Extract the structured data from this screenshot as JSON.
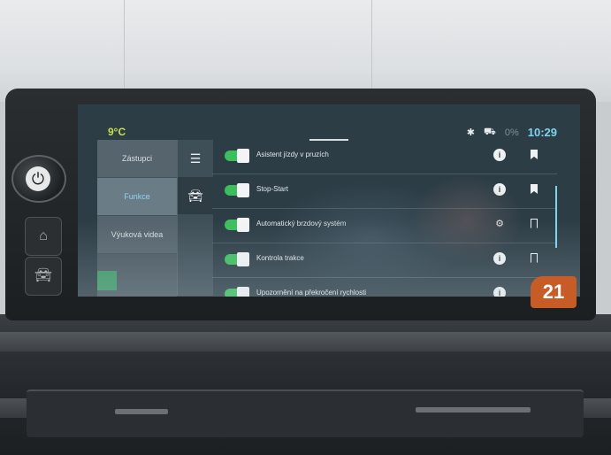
{
  "status_bar": {
    "temperature": "9°C",
    "bluetooth_icon": "bluetooth-icon",
    "car_icon": "car-icon",
    "signal_text": "0%",
    "time": "10:29"
  },
  "left_tabs": [
    {
      "label": "Zástupci"
    },
    {
      "label": "Funkce"
    },
    {
      "label": "Výuková videa"
    }
  ],
  "side_icons": [
    "menu-icon",
    "car-icon"
  ],
  "features": [
    {
      "label": "Asistent jízdy v pruzích",
      "enabled": true,
      "action_icon": "info-icon",
      "bookmark": "filled"
    },
    {
      "label": "Stop-Start",
      "enabled": true,
      "action_icon": "info-icon",
      "bookmark": "filled"
    },
    {
      "label": "Automatický brzdový systém",
      "enabled": true,
      "action_icon": "gear-icon",
      "bookmark": "outline"
    },
    {
      "label": "Kontrola trakce",
      "enabled": true,
      "action_icon": "info-icon",
      "bookmark": "outline"
    },
    {
      "label": "Upozornění na překročení rychlosti",
      "enabled": true,
      "action_icon": "info-icon",
      "bookmark": "outline"
    }
  ],
  "photo_badge": "21",
  "colors": {
    "accent_cyan": "#7ed3ef",
    "temperature_lime": "#c6e14a",
    "toggle_green": "#3bbf5b"
  }
}
